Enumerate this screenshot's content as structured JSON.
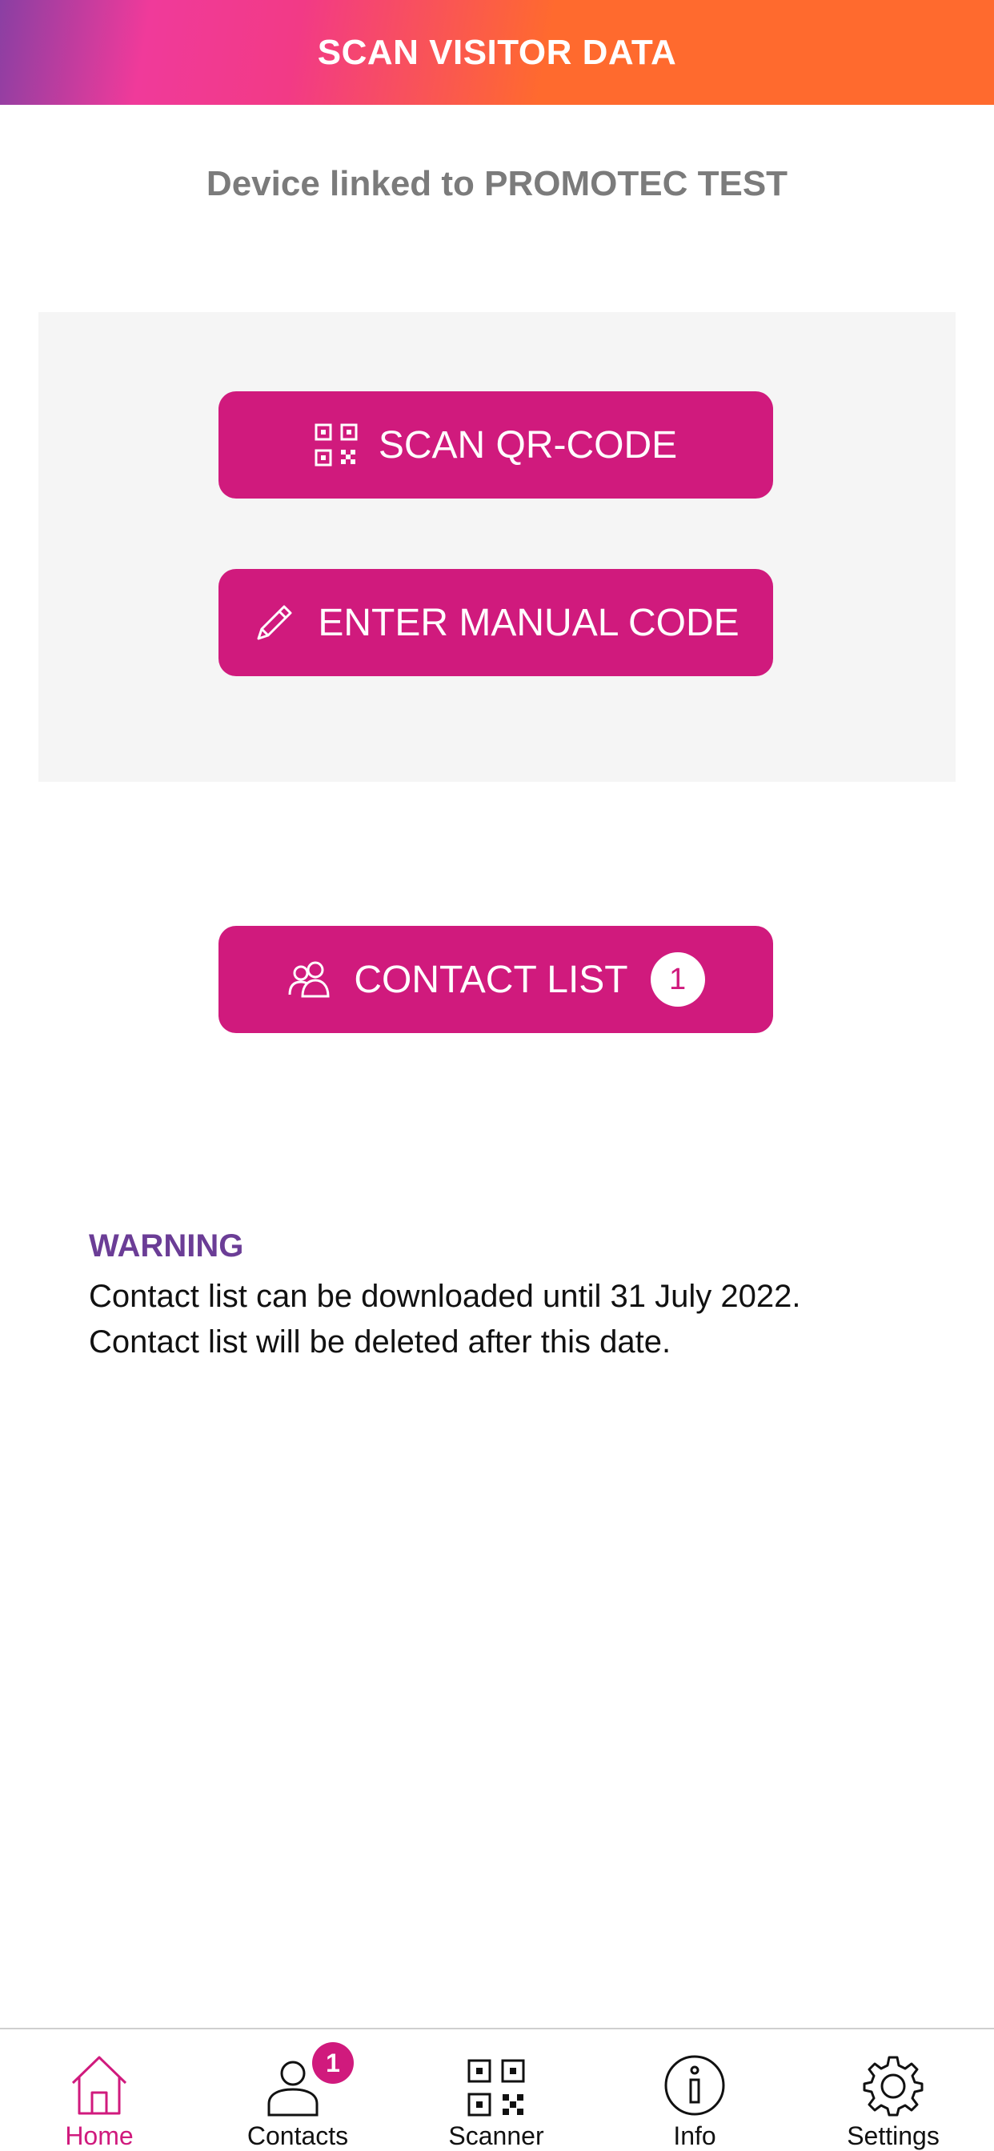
{
  "header": {
    "title": "SCAN VISITOR DATA"
  },
  "device": {
    "linked_text": "Device linked to PROMOTEC TEST"
  },
  "actions": {
    "scan_qr_label": "SCAN QR-CODE",
    "manual_code_label": "ENTER MANUAL CODE",
    "contact_list_label": "CONTACT LIST",
    "contact_count": "1"
  },
  "warning": {
    "title": "WARNING",
    "line1": "Contact list can be downloaded until 31 July 2022.",
    "line2": "Contact list will be deleted after this date."
  },
  "tabbar": {
    "items": [
      {
        "label": "Home",
        "icon": "home-icon",
        "active": true
      },
      {
        "label": "Contacts",
        "icon": "contacts-icon",
        "badge": "1"
      },
      {
        "label": "Scanner",
        "icon": "qr-code-icon"
      },
      {
        "label": "Info",
        "icon": "info-icon"
      },
      {
        "label": "Settings",
        "icon": "gear-icon"
      }
    ]
  },
  "colors": {
    "accent": "#d01a7d",
    "warning_title": "#6b3d96",
    "header_gradient": [
      "#8a3fa3",
      "#f03a9a",
      "#ff6a2e"
    ],
    "panel_bg": "#f5f5f5"
  }
}
